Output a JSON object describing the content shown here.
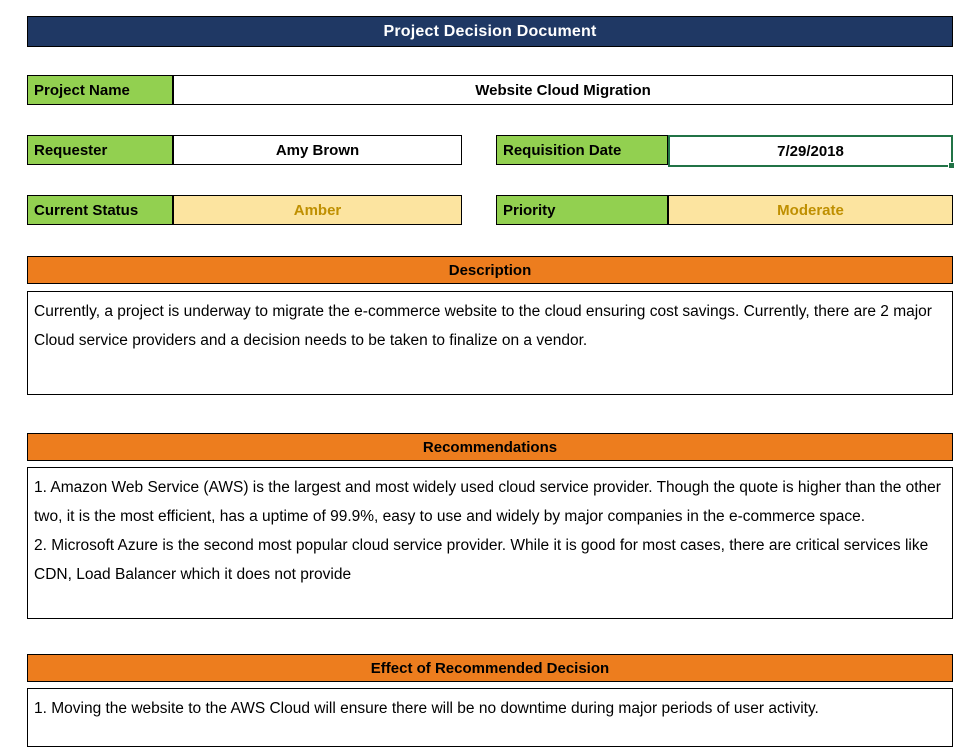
{
  "document": {
    "title": "Project Decision Document"
  },
  "fields": {
    "project_name": {
      "label": "Project Name",
      "value": "Website Cloud Migration"
    },
    "requester": {
      "label": "Requester",
      "value": "Amy Brown"
    },
    "requisition_date": {
      "label": "Requisition Date",
      "value": "7/29/2018"
    },
    "current_status": {
      "label": "Current Status",
      "value": "Amber"
    },
    "priority": {
      "label": "Priority",
      "value": "Moderate"
    }
  },
  "sections": {
    "description": {
      "header": "Description",
      "body": "Currently, a project is underway to migrate the e-commerce website to the cloud ensuring cost savings. Currently, there are 2 major Cloud service providers and a decision needs to be taken to finalize on a vendor."
    },
    "recommendations": {
      "header": "Recommendations",
      "item_1": "1. Amazon Web Service (AWS) is the largest and most widely used cloud service provider. Though the quote is higher than the other two, it is the most efficient, has a uptime of 99.9%, easy to use and widely by major companies in the e-commerce space.",
      "item_2": "2. Microsoft Azure is the second most popular cloud service provider. While it is good for most cases, there are critical services like CDN, Load Balancer which it does not provide"
    },
    "effect": {
      "header": "Effect of Recommended Decision",
      "item_1": "1. Moving the website to the AWS Cloud will ensure there will be no downtime during major periods of user activity."
    }
  },
  "colors": {
    "title_bar": "#1F3864",
    "label_green": "#92D050",
    "section_orange": "#ED7D1E",
    "amber_fill": "#FCE4A0",
    "amber_text": "#BF8F00",
    "selection_green": "#217346",
    "border": "#000000"
  }
}
